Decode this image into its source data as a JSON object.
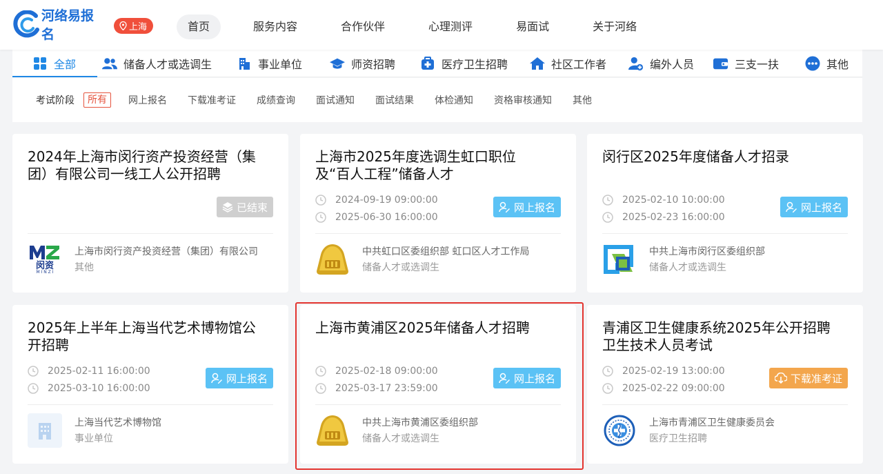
{
  "header": {
    "logo_text": "河络易报名",
    "logo_caption": "HE LUO YI BAO MING",
    "city": "上海",
    "nav": [
      {
        "label": "首页",
        "active": true
      },
      {
        "label": "服务内容"
      },
      {
        "label": "合作伙伴"
      },
      {
        "label": "心理测评"
      },
      {
        "label": "易面试"
      },
      {
        "label": "关于河络"
      }
    ]
  },
  "categories": [
    {
      "label": "全部",
      "icon": "grid-icon",
      "active": true
    },
    {
      "label": "储备人才或选调生",
      "icon": "users-icon"
    },
    {
      "label": "事业单位",
      "icon": "building-icon"
    },
    {
      "label": "师资招聘",
      "icon": "graduation-cap-icon"
    },
    {
      "label": "医疗卫生招聘",
      "icon": "medical-kit-icon"
    },
    {
      "label": "社区工作者",
      "icon": "home-icon"
    },
    {
      "label": "编外人员",
      "icon": "user-add-icon"
    },
    {
      "label": "三支一扶",
      "icon": "wallet-icon"
    },
    {
      "label": "其他",
      "icon": "more-icon"
    }
  ],
  "stages": {
    "title": "考试阶段",
    "items": [
      "所有",
      "网上报名",
      "下载准考证",
      "成绩查询",
      "面试通知",
      "面试结果",
      "体检通知",
      "资格审核通知",
      "其他"
    ]
  },
  "cards": [
    {
      "title_lines": [
        "2024年上海市闵行资产投资经营（集",
        "团）有限公司一线工人公开招聘"
      ],
      "dates": [],
      "action": "已结束",
      "action_style": "gray",
      "action_icon": "layers-icon",
      "org_name": "上海市闵行资产投资经营（集团）有限公司",
      "org_category": "其他",
      "org_logo": "mz-logo",
      "org_logo_text": "闵资",
      "org_logo_sub": "M I N Z I"
    },
    {
      "title_lines": [
        "上海市2025年度选调生虹口职位",
        "及“百人工程”储备人才"
      ],
      "dates": [
        "2024-09-19 09:00:00",
        "2025-06-30 16:00:00"
      ],
      "action": "网上报名",
      "action_style": "blue",
      "action_icon": "edit-user-icon",
      "org_name": "中共虹口区委组织部 虹口区人才工作局",
      "org_category": "储备人才或选调生",
      "org_logo": "party-emblem"
    },
    {
      "title_lines": [
        "闵行区2025年度储备人才招录"
      ],
      "dates": [
        "2025-02-10 10:00:00",
        "2025-02-23 16:00:00"
      ],
      "action": "网上报名",
      "action_style": "blue",
      "action_icon": "edit-user-icon",
      "org_name": "中共上海市闵行区委组织部",
      "org_category": "储备人才或选调生",
      "org_logo": "minhang-logo"
    },
    {
      "title_lines": [
        "2025年上半年上海当代艺术博物馆公",
        "开招聘"
      ],
      "dates": [
        "2025-02-11 16:00:00",
        "2025-03-10 16:00:00"
      ],
      "action": "网上报名",
      "action_style": "blue",
      "action_icon": "edit-user-icon",
      "org_name": "上海当代艺术博物馆",
      "org_category": "事业单位",
      "org_logo": "building-placeholder"
    },
    {
      "title_lines": [
        "上海市黄浦区2025年储备人才招聘"
      ],
      "dates": [
        "2025-02-18 09:00:00",
        "2025-03-17 23:59:00"
      ],
      "action": "网上报名",
      "action_style": "blue",
      "action_icon": "edit-user-icon",
      "org_name": "中共上海市黄浦区委组织部",
      "org_category": "储备人才或选调生",
      "org_logo": "party-emblem"
    },
    {
      "title_lines": [
        "青浦区卫生健康系统2025年公开招聘",
        "卫生技术人员考试"
      ],
      "dates": [
        "2025-02-19 13:00:00",
        "2025-02-22 09:00:00"
      ],
      "action": "下载准考证",
      "action_style": "orange",
      "action_icon": "cloud-download-icon",
      "org_name": "上海市青浦区卫生健康委员会",
      "org_category": "医疗卫生招聘",
      "org_logo": "health-commission-seal"
    }
  ],
  "colors": {
    "brand_blue": "#1f6fd6",
    "active_tab": "#1f88e5",
    "city_badge": "#f04f3b",
    "action_blue": "#5bc2f5",
    "action_orange": "#f3a64d",
    "action_gray": "#cfcfcf",
    "highlight": "#e3342f"
  }
}
